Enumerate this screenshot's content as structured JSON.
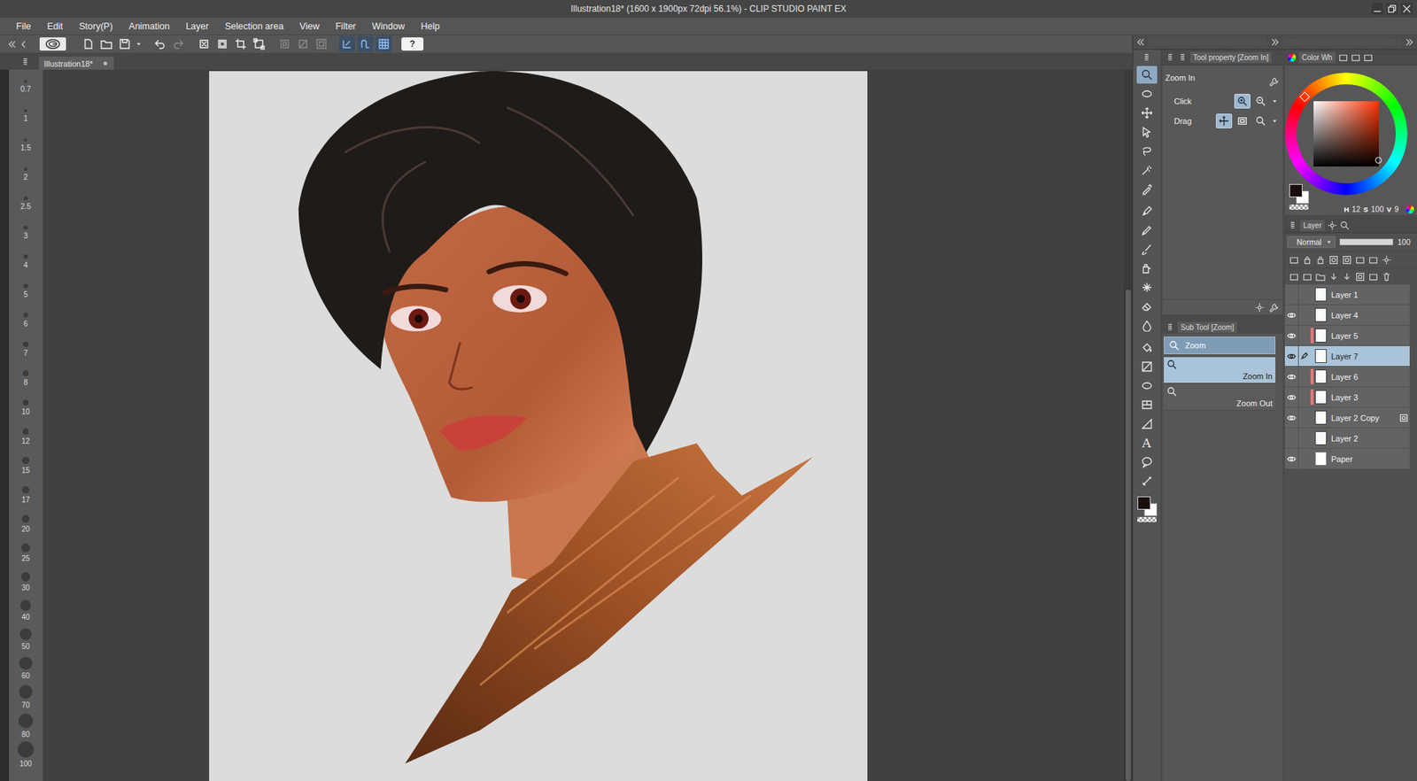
{
  "window": {
    "title": "Illustration18* (1600 x 1900px 72dpi 56.1%) - CLIP STUDIO PAINT EX"
  },
  "menu": [
    "File",
    "Edit",
    "Story(P)",
    "Animation",
    "Layer",
    "Selection area",
    "View",
    "Filter",
    "Window",
    "Help"
  ],
  "command_bar": [
    {
      "kind": "logo",
      "disabled": false,
      "on": false
    },
    {
      "kind": "new",
      "disabled": false,
      "on": false
    },
    {
      "kind": "open",
      "disabled": false,
      "on": false
    },
    {
      "kind": "save",
      "disabled": false,
      "on": false
    },
    {
      "kind": "dropdown",
      "disabled": false,
      "on": false
    },
    {
      "kind": "undo",
      "disabled": false,
      "on": false
    },
    {
      "kind": "redo",
      "disabled": true,
      "on": false
    },
    {
      "kind": "erase-selection",
      "disabled": false,
      "on": false
    },
    {
      "kind": "fill-selection",
      "disabled": false,
      "on": false
    },
    {
      "kind": "crop",
      "disabled": false,
      "on": false
    },
    {
      "kind": "transform",
      "disabled": false,
      "on": false
    },
    {
      "kind": "deselect",
      "disabled": true,
      "on": false
    },
    {
      "kind": "invert",
      "disabled": true,
      "on": false
    },
    {
      "kind": "border",
      "disabled": true,
      "on": false
    },
    {
      "kind": "snap-ruler",
      "disabled": false,
      "on": true
    },
    {
      "kind": "snap-special",
      "disabled": false,
      "on": true
    },
    {
      "kind": "snap-grid",
      "disabled": false,
      "on": true
    },
    {
      "kind": "help",
      "glyph": "?",
      "disabled": false,
      "on": false
    }
  ],
  "document_tab": {
    "label": "Illustration18*",
    "selected": true
  },
  "brush_sizes": [
    "0.7",
    "1",
    "1.5",
    "2",
    "2.5",
    "3",
    "4",
    "5",
    "6",
    "7",
    "8",
    "10",
    "12",
    "15",
    "17",
    "20",
    "25",
    "30",
    "40",
    "50",
    "60",
    "70",
    "80",
    "100"
  ],
  "tools": [
    {
      "kind": "zoom",
      "selected": true
    },
    {
      "kind": "selection",
      "selected": false
    },
    {
      "kind": "move",
      "selected": false
    },
    {
      "kind": "operation",
      "selected": false
    },
    {
      "kind": "lasso",
      "selected": false
    },
    {
      "kind": "wand",
      "selected": false
    },
    {
      "kind": "eyedropper",
      "selected": false
    },
    {
      "kind": "pen",
      "selected": false
    },
    {
      "kind": "pencil",
      "selected": false
    },
    {
      "kind": "brush",
      "selected": false
    },
    {
      "kind": "airbrush",
      "selected": false
    },
    {
      "kind": "decoration",
      "selected": false
    },
    {
      "kind": "eraser",
      "selected": false
    },
    {
      "kind": "blend",
      "selected": false
    },
    {
      "kind": "fill",
      "selected": false
    },
    {
      "kind": "gradient",
      "selected": false
    },
    {
      "kind": "figure",
      "selected": false
    },
    {
      "kind": "frame",
      "selected": false
    },
    {
      "kind": "ruler",
      "selected": false
    },
    {
      "kind": "text",
      "glyph": "A",
      "selected": false
    },
    {
      "kind": "balloon",
      "selected": false
    },
    {
      "kind": "correct",
      "selected": false
    }
  ],
  "color_swatches": [
    {
      "name": "main",
      "color": "#1a0e0b"
    },
    {
      "name": "sub",
      "color": "#ffffff"
    }
  ],
  "tool_property": {
    "title": "Tool property [Zoom In]",
    "tool": "Zoom In",
    "rows": [
      {
        "label": "Click",
        "options": [
          {
            "kind": "zoom-in",
            "selected": true
          },
          {
            "kind": "zoom-out",
            "selected": false
          }
        ]
      },
      {
        "label": "Drag",
        "options": [
          {
            "kind": "drag-scroll",
            "selected": true
          },
          {
            "kind": "drag-rect",
            "selected": false
          },
          {
            "kind": "drag-zoom",
            "selected": false
          }
        ]
      }
    ]
  },
  "sub_tool": {
    "title": "Sub Tool [Zoom]",
    "group": "Zoom",
    "items": [
      {
        "label": "Zoom In",
        "selected": true
      },
      {
        "label": "Zoom Out",
        "selected": false
      }
    ]
  },
  "color_panel": {
    "tab": "Color Wh",
    "readout": [
      {
        "label": "H",
        "value": "12"
      },
      {
        "label": "S",
        "value": "100"
      },
      {
        "label": "V",
        "value": "9"
      }
    ]
  },
  "layer_panel": {
    "tab": "Layer",
    "blend_mode": "Normal",
    "opacity": {
      "value": "100",
      "level": 1
    },
    "layers": [
      {
        "name": "Layer 1",
        "kind": "raster",
        "visible": false,
        "clipped": false,
        "selected": false,
        "editing": false,
        "mask": false
      },
      {
        "name": "Layer 4",
        "kind": "raster",
        "visible": true,
        "clipped": false,
        "selected": false,
        "editing": false,
        "mask": false
      },
      {
        "name": "Layer 5",
        "kind": "raster",
        "visible": true,
        "clipped": true,
        "selected": false,
        "editing": false,
        "mask": false
      },
      {
        "name": "Layer 7",
        "kind": "raster",
        "visible": true,
        "clipped": false,
        "selected": true,
        "editing": true,
        "mask": false
      },
      {
        "name": "Layer 6",
        "kind": "raster",
        "visible": true,
        "clipped": true,
        "selected": false,
        "editing": false,
        "mask": false
      },
      {
        "name": "Layer 3",
        "kind": "raster",
        "visible": true,
        "clipped": true,
        "selected": false,
        "editing": false,
        "mask": false
      },
      {
        "name": "Layer 2 Copy",
        "kind": "raster",
        "visible": true,
        "clipped": false,
        "selected": false,
        "editing": false,
        "mask": true
      },
      {
        "name": "Layer 2",
        "kind": "raster",
        "visible": false,
        "clipped": false,
        "selected": false,
        "editing": false,
        "mask": false
      },
      {
        "name": "Paper",
        "kind": "paper",
        "visible": true,
        "clipped": false,
        "selected": false,
        "editing": false,
        "mask": false
      }
    ]
  }
}
